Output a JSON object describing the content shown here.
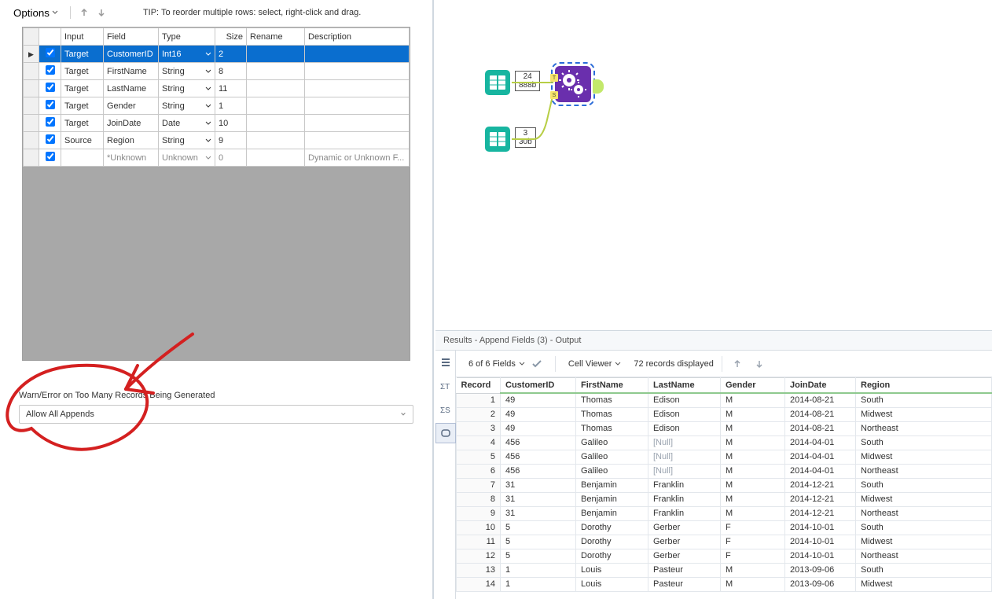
{
  "toolbar": {
    "options_label": "Options",
    "tip": "TIP: To reorder multiple rows: select, right-click and drag."
  },
  "config": {
    "headers": {
      "input": "Input",
      "field": "Field",
      "type": "Type",
      "size": "Size",
      "rename": "Rename",
      "description": "Description"
    },
    "rows": [
      {
        "checked": true,
        "selected": true,
        "input": "Target",
        "field": "CustomerID",
        "type": "Int16",
        "size": "2",
        "rename": "",
        "description": ""
      },
      {
        "checked": true,
        "selected": false,
        "input": "Target",
        "field": "FirstName",
        "type": "String",
        "size": "8",
        "rename": "",
        "description": ""
      },
      {
        "checked": true,
        "selected": false,
        "input": "Target",
        "field": "LastName",
        "type": "String",
        "size": "11",
        "rename": "",
        "description": ""
      },
      {
        "checked": true,
        "selected": false,
        "input": "Target",
        "field": "Gender",
        "type": "String",
        "size": "1",
        "rename": "",
        "description": ""
      },
      {
        "checked": true,
        "selected": false,
        "input": "Target",
        "field": "JoinDate",
        "type": "Date",
        "size": "10",
        "rename": "",
        "description": ""
      },
      {
        "checked": true,
        "selected": false,
        "input": "Source",
        "field": "Region",
        "type": "String",
        "size": "9",
        "rename": "",
        "description": ""
      },
      {
        "checked": true,
        "selected": false,
        "input": "",
        "field": "*Unknown",
        "type": "Unknown",
        "size": "0",
        "rename": "",
        "description": "Dynamic or Unknown F...",
        "muted": true
      }
    ]
  },
  "warn": {
    "label": "Warn/Error on Too Many Records Being Generated",
    "value": "Allow All Appends"
  },
  "canvas": {
    "node1": {
      "records": "24",
      "bytes": "888b"
    },
    "node2": {
      "records": "3",
      "bytes": "30b"
    }
  },
  "results": {
    "title": "Results - Append Fields (3) - Output",
    "fields_label": "6 of 6 Fields",
    "cell_viewer_label": "Cell Viewer",
    "records_label": "72 records displayed",
    "headers": {
      "record": "Record",
      "customerid": "CustomerID",
      "firstname": "FirstName",
      "lastname": "LastName",
      "gender": "Gender",
      "joindate": "JoinDate",
      "region": "Region"
    },
    "rows": [
      {
        "n": 1,
        "CustomerID": "49",
        "FirstName": "Thomas",
        "LastName": "Edison",
        "Gender": "M",
        "JoinDate": "2014-08-21",
        "Region": "South"
      },
      {
        "n": 2,
        "CustomerID": "49",
        "FirstName": "Thomas",
        "LastName": "Edison",
        "Gender": "M",
        "JoinDate": "2014-08-21",
        "Region": "Midwest"
      },
      {
        "n": 3,
        "CustomerID": "49",
        "FirstName": "Thomas",
        "LastName": "Edison",
        "Gender": "M",
        "JoinDate": "2014-08-21",
        "Region": "Northeast"
      },
      {
        "n": 4,
        "CustomerID": "456",
        "FirstName": "Galileo",
        "LastName": "[Null]",
        "Gender": "M",
        "JoinDate": "2014-04-01",
        "Region": "South",
        "null_last": true
      },
      {
        "n": 5,
        "CustomerID": "456",
        "FirstName": "Galileo",
        "LastName": "[Null]",
        "Gender": "M",
        "JoinDate": "2014-04-01",
        "Region": "Midwest",
        "null_last": true
      },
      {
        "n": 6,
        "CustomerID": "456",
        "FirstName": "Galileo",
        "LastName": "[Null]",
        "Gender": "M",
        "JoinDate": "2014-04-01",
        "Region": "Northeast",
        "null_last": true
      },
      {
        "n": 7,
        "CustomerID": "31",
        "FirstName": "Benjamin",
        "LastName": "Franklin",
        "Gender": "M",
        "JoinDate": "2014-12-21",
        "Region": "South"
      },
      {
        "n": 8,
        "CustomerID": "31",
        "FirstName": "Benjamin",
        "LastName": "Franklin",
        "Gender": "M",
        "JoinDate": "2014-12-21",
        "Region": "Midwest"
      },
      {
        "n": 9,
        "CustomerID": "31",
        "FirstName": "Benjamin",
        "LastName": "Franklin",
        "Gender": "M",
        "JoinDate": "2014-12-21",
        "Region": "Northeast"
      },
      {
        "n": 10,
        "CustomerID": "5",
        "FirstName": "Dorothy",
        "LastName": "Gerber",
        "Gender": "F",
        "JoinDate": "2014-10-01",
        "Region": "South"
      },
      {
        "n": 11,
        "CustomerID": "5",
        "FirstName": "Dorothy",
        "LastName": "Gerber",
        "Gender": "F",
        "JoinDate": "2014-10-01",
        "Region": "Midwest"
      },
      {
        "n": 12,
        "CustomerID": "5",
        "FirstName": "Dorothy",
        "LastName": "Gerber",
        "Gender": "F",
        "JoinDate": "2014-10-01",
        "Region": "Northeast"
      },
      {
        "n": 13,
        "CustomerID": "1",
        "FirstName": "Louis",
        "LastName": "Pasteur",
        "Gender": "M",
        "JoinDate": "2013-09-06",
        "Region": "South"
      },
      {
        "n": 14,
        "CustomerID": "1",
        "FirstName": "Louis",
        "LastName": "Pasteur",
        "Gender": "M",
        "JoinDate": "2013-09-06",
        "Region": "Midwest"
      }
    ]
  }
}
